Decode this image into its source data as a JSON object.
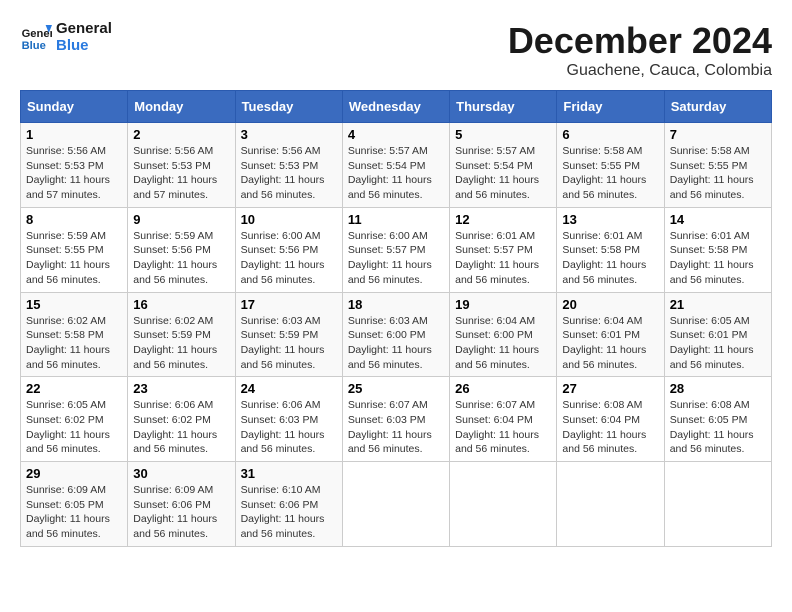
{
  "logo": {
    "line1": "General",
    "line2": "Blue"
  },
  "title": "December 2024",
  "location": "Guachene, Cauca, Colombia",
  "weekdays": [
    "Sunday",
    "Monday",
    "Tuesday",
    "Wednesday",
    "Thursday",
    "Friday",
    "Saturday"
  ],
  "weeks": [
    [
      {
        "day": "1",
        "sunrise": "5:56 AM",
        "sunset": "5:53 PM",
        "daylight": "11 hours and 57 minutes."
      },
      {
        "day": "2",
        "sunrise": "5:56 AM",
        "sunset": "5:53 PM",
        "daylight": "11 hours and 57 minutes."
      },
      {
        "day": "3",
        "sunrise": "5:56 AM",
        "sunset": "5:53 PM",
        "daylight": "11 hours and 56 minutes."
      },
      {
        "day": "4",
        "sunrise": "5:57 AM",
        "sunset": "5:54 PM",
        "daylight": "11 hours and 56 minutes."
      },
      {
        "day": "5",
        "sunrise": "5:57 AM",
        "sunset": "5:54 PM",
        "daylight": "11 hours and 56 minutes."
      },
      {
        "day": "6",
        "sunrise": "5:58 AM",
        "sunset": "5:55 PM",
        "daylight": "11 hours and 56 minutes."
      },
      {
        "day": "7",
        "sunrise": "5:58 AM",
        "sunset": "5:55 PM",
        "daylight": "11 hours and 56 minutes."
      }
    ],
    [
      {
        "day": "8",
        "sunrise": "5:59 AM",
        "sunset": "5:55 PM",
        "daylight": "11 hours and 56 minutes."
      },
      {
        "day": "9",
        "sunrise": "5:59 AM",
        "sunset": "5:56 PM",
        "daylight": "11 hours and 56 minutes."
      },
      {
        "day": "10",
        "sunrise": "6:00 AM",
        "sunset": "5:56 PM",
        "daylight": "11 hours and 56 minutes."
      },
      {
        "day": "11",
        "sunrise": "6:00 AM",
        "sunset": "5:57 PM",
        "daylight": "11 hours and 56 minutes."
      },
      {
        "day": "12",
        "sunrise": "6:01 AM",
        "sunset": "5:57 PM",
        "daylight": "11 hours and 56 minutes."
      },
      {
        "day": "13",
        "sunrise": "6:01 AM",
        "sunset": "5:58 PM",
        "daylight": "11 hours and 56 minutes."
      },
      {
        "day": "14",
        "sunrise": "6:01 AM",
        "sunset": "5:58 PM",
        "daylight": "11 hours and 56 minutes."
      }
    ],
    [
      {
        "day": "15",
        "sunrise": "6:02 AM",
        "sunset": "5:58 PM",
        "daylight": "11 hours and 56 minutes."
      },
      {
        "day": "16",
        "sunrise": "6:02 AM",
        "sunset": "5:59 PM",
        "daylight": "11 hours and 56 minutes."
      },
      {
        "day": "17",
        "sunrise": "6:03 AM",
        "sunset": "5:59 PM",
        "daylight": "11 hours and 56 minutes."
      },
      {
        "day": "18",
        "sunrise": "6:03 AM",
        "sunset": "6:00 PM",
        "daylight": "11 hours and 56 minutes."
      },
      {
        "day": "19",
        "sunrise": "6:04 AM",
        "sunset": "6:00 PM",
        "daylight": "11 hours and 56 minutes."
      },
      {
        "day": "20",
        "sunrise": "6:04 AM",
        "sunset": "6:01 PM",
        "daylight": "11 hours and 56 minutes."
      },
      {
        "day": "21",
        "sunrise": "6:05 AM",
        "sunset": "6:01 PM",
        "daylight": "11 hours and 56 minutes."
      }
    ],
    [
      {
        "day": "22",
        "sunrise": "6:05 AM",
        "sunset": "6:02 PM",
        "daylight": "11 hours and 56 minutes."
      },
      {
        "day": "23",
        "sunrise": "6:06 AM",
        "sunset": "6:02 PM",
        "daylight": "11 hours and 56 minutes."
      },
      {
        "day": "24",
        "sunrise": "6:06 AM",
        "sunset": "6:03 PM",
        "daylight": "11 hours and 56 minutes."
      },
      {
        "day": "25",
        "sunrise": "6:07 AM",
        "sunset": "6:03 PM",
        "daylight": "11 hours and 56 minutes."
      },
      {
        "day": "26",
        "sunrise": "6:07 AM",
        "sunset": "6:04 PM",
        "daylight": "11 hours and 56 minutes."
      },
      {
        "day": "27",
        "sunrise": "6:08 AM",
        "sunset": "6:04 PM",
        "daylight": "11 hours and 56 minutes."
      },
      {
        "day": "28",
        "sunrise": "6:08 AM",
        "sunset": "6:05 PM",
        "daylight": "11 hours and 56 minutes."
      }
    ],
    [
      {
        "day": "29",
        "sunrise": "6:09 AM",
        "sunset": "6:05 PM",
        "daylight": "11 hours and 56 minutes."
      },
      {
        "day": "30",
        "sunrise": "6:09 AM",
        "sunset": "6:06 PM",
        "daylight": "11 hours and 56 minutes."
      },
      {
        "day": "31",
        "sunrise": "6:10 AM",
        "sunset": "6:06 PM",
        "daylight": "11 hours and 56 minutes."
      },
      null,
      null,
      null,
      null
    ]
  ],
  "labels": {
    "sunrise": "Sunrise:",
    "sunset": "Sunset:",
    "daylight": "Daylight:"
  }
}
